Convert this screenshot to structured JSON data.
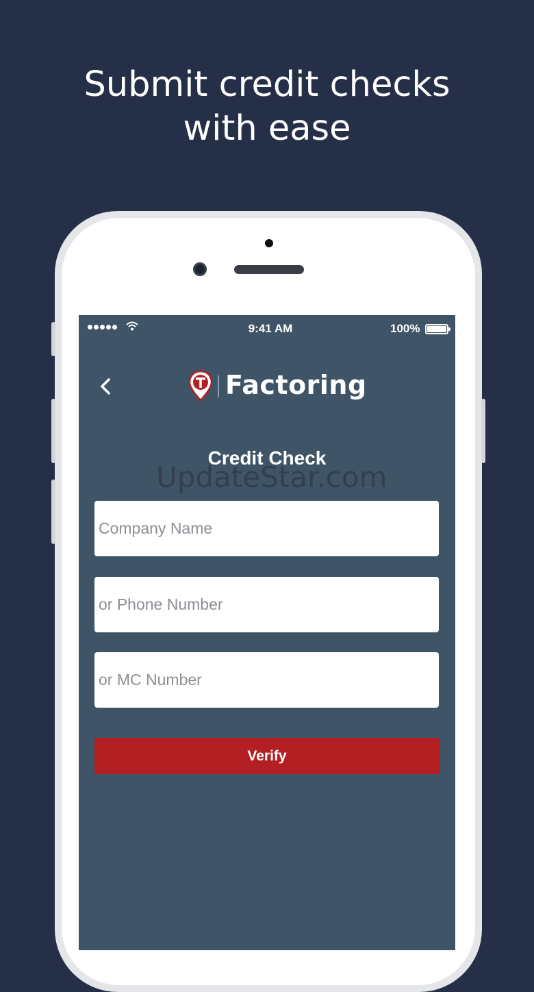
{
  "headline": {
    "line1": "Submit credit checks",
    "line2": "with ease"
  },
  "status_bar": {
    "time": "9:41 AM",
    "battery": "100%",
    "signal_icon": "signal-dots-icon",
    "wifi_icon": "wifi-icon"
  },
  "nav": {
    "back_icon": "chevron-left-icon",
    "logo_icon": "map-pin-logo-icon",
    "brand": "Factoring"
  },
  "form": {
    "title": "Credit Check",
    "company_placeholder": "Company Name",
    "phone_placeholder": "or Phone Number",
    "mc_placeholder": "or MC Number",
    "verify_label": "Verify"
  },
  "watermark": "UpdateStar.com",
  "colors": {
    "page_background": "#262f48",
    "screen_background": "#405467",
    "accent": "#b41f24"
  }
}
